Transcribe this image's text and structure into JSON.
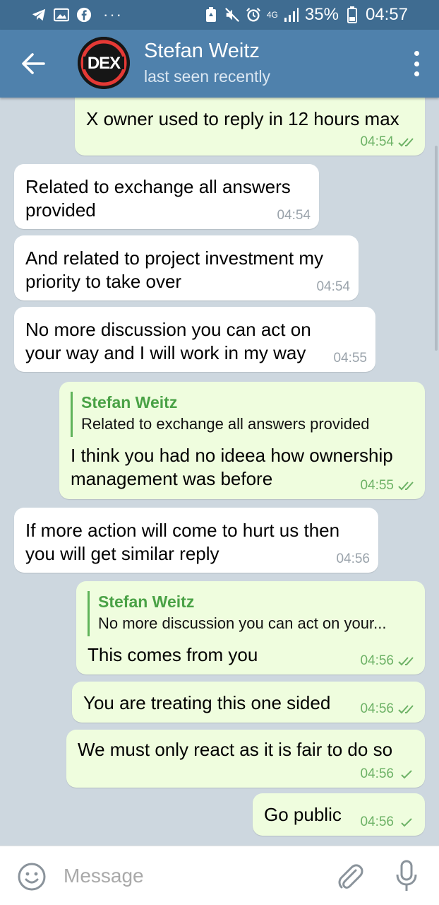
{
  "status_bar": {
    "network": "4G",
    "battery": "35%",
    "time": "04:57",
    "icons": [
      "telegram-icon",
      "gallery-icon",
      "facebook-icon",
      "more-notifications-icon",
      "battery-saver-icon",
      "mute-icon",
      "alarm-icon",
      "signal-icon",
      "battery-icon"
    ]
  },
  "header": {
    "contact_name": "Stefan Weitz",
    "status": "last seen recently",
    "avatar_text": "DEX"
  },
  "messages": [
    {
      "dir": "out",
      "text": "X owner used to reply in 12 hours max",
      "time": "04:54",
      "state": "read"
    },
    {
      "dir": "in",
      "text": "Related to exchange all answers provided",
      "time": "04:54"
    },
    {
      "dir": "in",
      "text": "And related to project investment my priority to take over",
      "time": "04:54"
    },
    {
      "dir": "in",
      "text": "No more discussion you can act on your way and I will work in my way",
      "time": "04:55"
    },
    {
      "dir": "out",
      "reply_to": {
        "name": "Stefan Weitz",
        "text": "Related to exchange all answers provided"
      },
      "text": "I think you had no ideea how ownership management was before",
      "time": "04:55",
      "state": "read"
    },
    {
      "dir": "in",
      "text": "If more action will come to hurt us then you will get similar reply",
      "time": "04:56"
    },
    {
      "dir": "out",
      "reply_to": {
        "name": "Stefan Weitz",
        "text": "No more discussion you can act on your..."
      },
      "text": "This comes from you",
      "time": "04:56",
      "state": "read"
    },
    {
      "dir": "out",
      "text": "You are treating this one sided",
      "time": "04:56",
      "state": "read"
    },
    {
      "dir": "out",
      "text": "We must only react as it is fair to do so",
      "time": "04:56",
      "state": "sent"
    },
    {
      "dir": "out",
      "text": "Go public",
      "time": "04:56",
      "state": "sent"
    }
  ],
  "input": {
    "placeholder": "Message",
    "value": ""
  },
  "colors": {
    "header": "#4f81ac",
    "status_bar": "#3f6c91",
    "outgoing_bubble": "#effdde",
    "incoming_bubble": "#ffffff",
    "accent_green": "#5fb35a"
  }
}
